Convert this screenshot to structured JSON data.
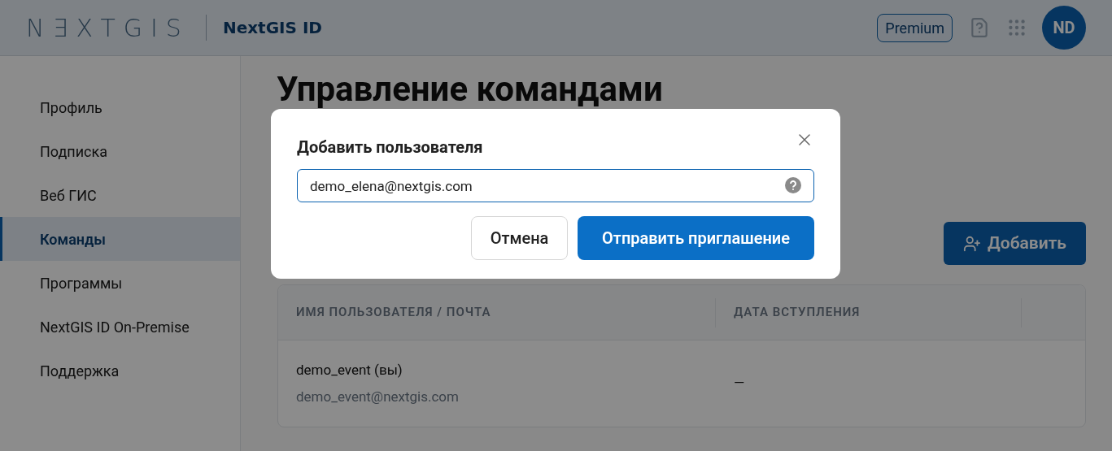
{
  "header": {
    "logo": "NƎXTGIS",
    "product": "NextGIS ID",
    "plan_badge": "Premium",
    "avatar_initials": "ND"
  },
  "sidebar": {
    "items": [
      {
        "label": "Профиль",
        "selected": false
      },
      {
        "label": "Подписка",
        "selected": false
      },
      {
        "label": "Веб ГИС",
        "selected": false
      },
      {
        "label": "Команды",
        "selected": true
      },
      {
        "label": "Программы",
        "selected": false
      },
      {
        "label": "NextGIS ID On-Premise",
        "selected": false
      },
      {
        "label": "Поддержка",
        "selected": false
      }
    ]
  },
  "page": {
    "title": "Управление командами",
    "add_button": "Добавить"
  },
  "table": {
    "columns": [
      "ИМЯ ПОЛЬЗОВАТЕЛЯ / ПОЧТА",
      "ДАТА ВСТУПЛЕНИЯ"
    ],
    "rows": [
      {
        "name": "demo_event (вы)",
        "email": "demo_event@nextgis.com",
        "joined": "—"
      }
    ]
  },
  "dialog": {
    "title": "Добавить пользователя",
    "email_value": "demo_elena@nextgis.com",
    "cancel": "Отмена",
    "submit": "Отправить приглашение"
  }
}
